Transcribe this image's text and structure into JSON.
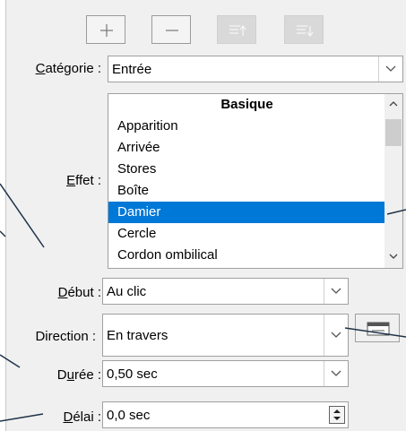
{
  "toolbar": {
    "add_icon": "plus-icon",
    "remove_icon": "minus-icon",
    "move_up_icon": "move-up-icon",
    "move_down_icon": "move-down-icon"
  },
  "category": {
    "label": "Catégorie :",
    "value": "Entrée"
  },
  "effect": {
    "label": "Effet :",
    "group_header": "Basique",
    "items": [
      "Apparition",
      "Arrivée",
      "Stores",
      "Boîte",
      "Damier",
      "Cercle",
      "Cordon ombilical"
    ],
    "selected": "Damier"
  },
  "start": {
    "label": "Début :",
    "value": "Au clic"
  },
  "direction": {
    "label": "Direction :",
    "value": "En travers"
  },
  "duration": {
    "label": "Durée :",
    "value": "0,50 sec"
  },
  "delay": {
    "label": "Délai :",
    "value": "0,0 sec"
  },
  "colors": {
    "selection": "#0078d7",
    "panel": "#f0f0f0",
    "annotation_line": "#1f3349"
  }
}
